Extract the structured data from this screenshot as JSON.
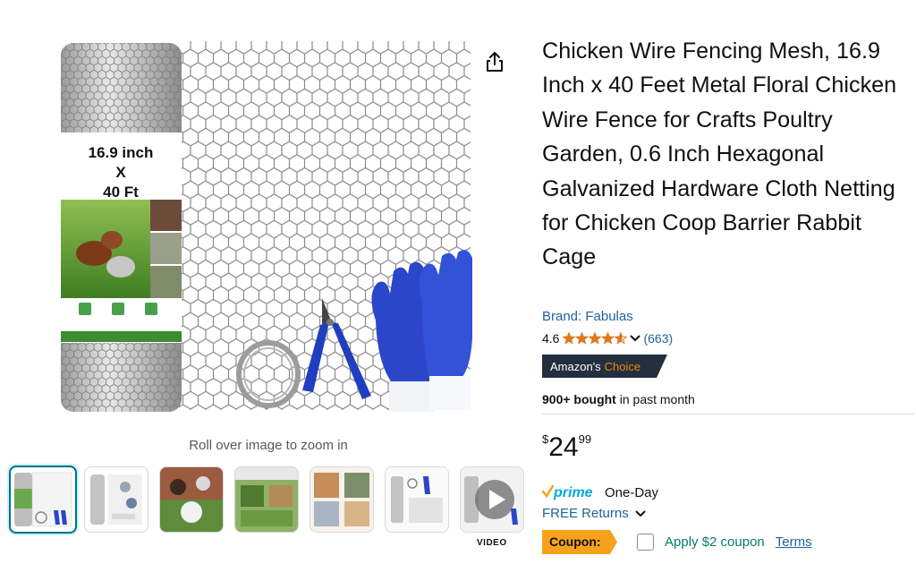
{
  "product": {
    "title": "Chicken Wire Fencing Mesh, 16.9 Inch x 40 Feet Metal Floral Chicken Wire Fence for Crafts Poultry Garden, 0.6 Inch Hexagonal Galvanized Hardware Cloth Netting for Chicken Coop Barrier Rabbit Cage",
    "brand": "Brand: Fabulas",
    "rating": "4.6",
    "rating_value": 4.6,
    "rating_count": "(663)",
    "badge": {
      "prefix": "Amazon's",
      "accent": "Choice"
    },
    "bought_bold": "900+ bought",
    "bought_rest": " in past month"
  },
  "image": {
    "roll_label_line1": "16.9 inch",
    "roll_label_line2": "X",
    "roll_label_line3": "40 Ft",
    "zoom_hint": "Roll over image to zoom in"
  },
  "thumbnails": {
    "count": 7,
    "video_label": "VIDEO"
  },
  "price": {
    "symbol": "$",
    "whole": "24",
    "fraction": "99"
  },
  "delivery": {
    "prime": "prime",
    "prime_suffix": "One-Day",
    "returns": "FREE Returns"
  },
  "coupon": {
    "tag": "Coupon:",
    "apply": "Apply $2 coupon",
    "terms": "Terms"
  },
  "colors": {
    "link": "#2162a1",
    "star": "#de7921",
    "coupon": "#f7a21b",
    "badge_bg": "#232f3e",
    "prime_blue": "#00a8e1"
  }
}
